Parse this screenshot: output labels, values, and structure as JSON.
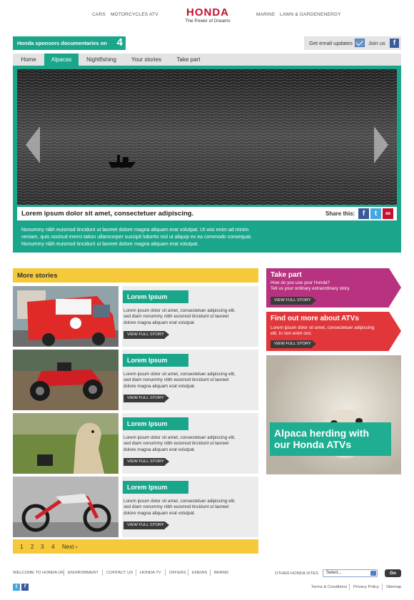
{
  "topnav": {
    "left": [
      "CARS",
      "MOTORCYCLES",
      "ATV"
    ],
    "right": [
      "MARINE",
      "LAWN & GARDEN",
      "ENERGY"
    ],
    "brand": "HONDA",
    "tagline": "The Power of Dreams"
  },
  "sponsor": {
    "text": "Honda sponsors documentaries on",
    "channel": "4"
  },
  "email_bar": {
    "email_label": "Get email updates",
    "join_label": "Join us"
  },
  "tabs": [
    "Home",
    "Alpacas",
    "Nightfishing",
    "Your stories",
    "Take part"
  ],
  "active_tab": "Alpacas",
  "feature": {
    "caption": "Lorem ipsum dolor sit amet, consectetuer adipiscing.",
    "share_label": "Share this:",
    "text_lines": [
      "Nonummy nibh euismod tincidunt ut laoreet dolore magna aliquam erat volutpat. Ut wisi enim ad minim",
      "veniam, quis nostrud exerci tation ullamcorper suscipit lobortis nisl ut aliquip ex ea commodo consequat.",
      "Nonummy nibh euismod tincidunt ut laoreet dolore magna aliquam erat volutpat."
    ]
  },
  "more_stories": {
    "heading": "More stories",
    "items": [
      {
        "title": "Lorem Ipsum",
        "image": "ice-cream-van",
        "line1": "Lorem ipsum dolor sit amet, consectetuer adipiscing elit,",
        "line2": "sed diam nonummy nibh euismod tincidunt ut laoreet",
        "line3": "dolore magna aliquam erat volutpat.",
        "button": "VIEW FULL STORY"
      },
      {
        "title": "Lorem Ipsum",
        "image": "red-atv",
        "line1": "Lorem ipsum dolor sit amet, consectetuer adipiscing elit,",
        "line2": "sed diam nonummy nibh euismod tincidunt ut laoreet",
        "line3": "dolore magna aliquam erat volutpat.",
        "button": "VIEW FULL STORY"
      },
      {
        "title": "Lorem Ipsum",
        "image": "alpaca-field",
        "line1": "Lorem ipsum dolor sit amet, consectetuer adipiscing elit,",
        "line2": "sed diam nonummy nibh euismod tincidunt ut laoreet",
        "line3": "dolore magna aliquam erat volutpat.",
        "button": "VIEW FULL STORY"
      },
      {
        "title": "Lorem Ipsum",
        "image": "dirt-bike",
        "line1": "Lorem ipsum dolor sit amet, consectetuer adipiscing elit,",
        "line2": "sed diam nonummy nibh euismod tincidunt ut laoreet",
        "line3": "dolore magna aliquam erat volutpat.",
        "button": "VIEW FULL STORY"
      }
    ]
  },
  "pager": {
    "pages": [
      "1",
      "2",
      "3",
      "4"
    ],
    "next": "Next ›"
  },
  "promos": {
    "take_part": {
      "heading": "Take part",
      "line1": "How do you use your Honda?",
      "line2": "Tell us your ordinary extraordinary story.",
      "button": "VIEW FULL STORY"
    },
    "atvs": {
      "heading": "Find out more about ATVs",
      "line1": "Lorem ipsum dolor sit amet, consectetuer adipiscing",
      "line2": "elit. In non enim orci.",
      "button": "VIEW FULL STORY"
    },
    "alpaca": {
      "line1": "Alpaca herding with",
      "line2": "our Honda ATVs"
    }
  },
  "footer": {
    "links": [
      "WELCOME TO HONDA UK",
      "ENVIRONMENT",
      "CONTACT US",
      "HONDA TV",
      "OFFERS",
      "ENEWS",
      "BRAND"
    ],
    "other_label": "OTHER HONDA SITES",
    "select_value": "Select...",
    "go_label": "Go",
    "bottom_links": [
      "Terms & Conditions",
      "Privacy Policy",
      "Sitemap"
    ]
  },
  "colors": {
    "green": "#1aa68b",
    "yellow": "#f5c93a",
    "magenta": "#b8337f",
    "red": "#e2373a",
    "honda_red": "#c8102e"
  }
}
